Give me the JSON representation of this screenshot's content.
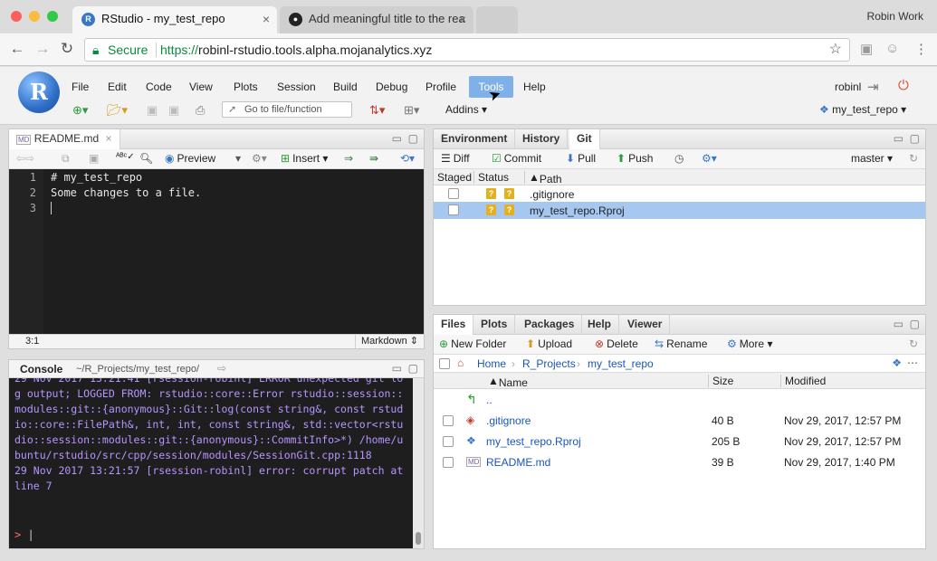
{
  "browser": {
    "tabs": [
      {
        "title": "RStudio - my_test_repo",
        "active": true,
        "icon": "rstudio-icon"
      },
      {
        "title": "Add meaningful title to the rea",
        "active": false,
        "icon": "github-icon"
      }
    ],
    "profile_name": "Robin Work",
    "secure_label": "Secure",
    "url_scheme": "https://",
    "url_host": "robinl-rstudio.tools.alpha.mojanalytics.xyz"
  },
  "rstudio": {
    "logo_letter": "R",
    "menu": [
      "File",
      "Edit",
      "Code",
      "View",
      "Plots",
      "Session",
      "Build",
      "Debug",
      "Profile",
      "Tools",
      "Help"
    ],
    "active_menu": "Tools",
    "user": "robinl",
    "goto_placeholder": "Go to file/function",
    "addins_label": "Addins",
    "project_label": "my_test_repo"
  },
  "editor": {
    "tab_label": "README.md",
    "toolbar": {
      "preview": "Preview",
      "insert": "Insert"
    },
    "lines": [
      "# my_test_repo",
      "Some changes to a file.",
      ""
    ],
    "line_numbers": [
      "1",
      "2",
      "3"
    ],
    "cursor_pos": "3:1",
    "mode": "Markdown"
  },
  "console": {
    "title": "Console",
    "path": "~/R_Projects/my_test_repo/",
    "lines": [
      "29 Nov 2017 13:21:41 [rsession-robinl] ERROR unexpected git log output; LOGGED FROM: rstudio::core::Error rstudio::session::modules::git::{anonymous}::Git::log(const string&, const rstudio::core::FilePath&, int, int, const string&, std::vector<rstudio::session::modules::git::{anonymous}::CommitInfo>*) /home/ubuntu/rstudio/src/cpp/session/modules/SessionGit.cpp:1118",
      "29 Nov 2017 13:21:57 [rsession-robinl] error: corrupt patch at line 7"
    ],
    "prompt": ">"
  },
  "envpane": {
    "tabs": [
      "Environment",
      "History",
      "Git"
    ],
    "active_tab": "Git",
    "toolbar": {
      "diff": "Diff",
      "commit": "Commit",
      "pull": "Pull",
      "push": "Push",
      "branch": "master"
    },
    "headers": {
      "staged": "Staged",
      "status": "Status",
      "path": "Path"
    },
    "rows": [
      {
        "path": ".gitignore",
        "status1": "?",
        "status2": "?",
        "selected": false
      },
      {
        "path": "my_test_repo.Rproj",
        "status1": "?",
        "status2": "?",
        "selected": true
      }
    ]
  },
  "filespane": {
    "tabs": [
      "Files",
      "Plots",
      "Packages",
      "Help",
      "Viewer"
    ],
    "active_tab": "Files",
    "toolbar": {
      "new_folder": "New Folder",
      "upload": "Upload",
      "delete": "Delete",
      "rename": "Rename",
      "more": "More"
    },
    "breadcrumb": [
      "Home",
      "R_Projects",
      "my_test_repo"
    ],
    "headers": {
      "name": "Name",
      "size": "Size",
      "modified": "Modified"
    },
    "parent": "..",
    "rows": [
      {
        "name": ".gitignore",
        "size": "40 B",
        "modified": "Nov 29, 2017, 12:57 PM",
        "icon": "gitignore-file-icon"
      },
      {
        "name": "my_test_repo.Rproj",
        "size": "205 B",
        "modified": "Nov 29, 2017, 12:57 PM",
        "icon": "rproj-file-icon"
      },
      {
        "name": "README.md",
        "size": "39 B",
        "modified": "Nov 29, 2017, 1:40 PM",
        "icon": "markdown-file-icon"
      }
    ]
  },
  "colors": {
    "accent": "#7fb1e8",
    "secure": "#0b8a3c",
    "console_text": "#b595ff",
    "prompt": "#ff6b6b",
    "git_badge": "#e4b020"
  }
}
